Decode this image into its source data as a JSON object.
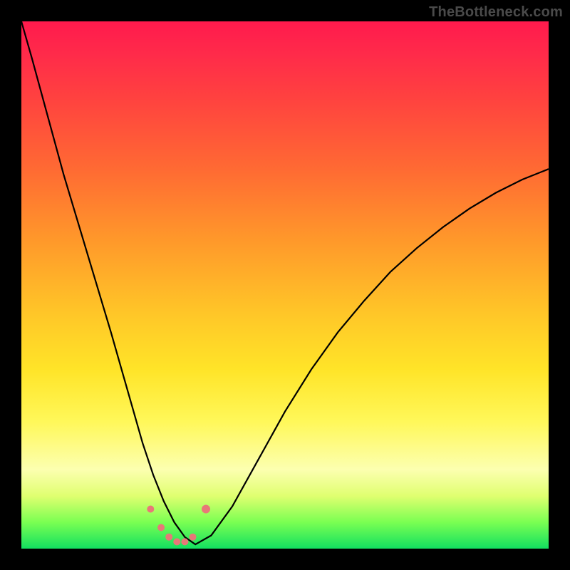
{
  "watermark": "TheBottleneck.com",
  "chart_data": {
    "type": "line",
    "title": "",
    "xlabel": "",
    "ylabel": "",
    "xlim": [
      0,
      100
    ],
    "ylim": [
      0,
      100
    ],
    "series": [
      {
        "name": "bottleneck-curve",
        "x": [
          0,
          2,
          5,
          8,
          11,
          14,
          17,
          19,
          21,
          23,
          25,
          27,
          29,
          31,
          33,
          36,
          40,
          45,
          50,
          55,
          60,
          65,
          70,
          75,
          80,
          85,
          90,
          95,
          100
        ],
        "y": [
          100,
          93,
          82,
          71,
          61,
          51,
          41,
          34,
          27,
          20,
          14,
          9,
          5,
          2.2,
          0.8,
          2.5,
          8,
          17,
          26,
          34,
          41,
          47,
          52.5,
          57,
          61,
          64.5,
          67.5,
          70,
          72
        ]
      }
    ],
    "markers": {
      "name": "highlight-points",
      "x": [
        24.5,
        26.5,
        28,
        29.5,
        31,
        32.5,
        35
      ],
      "y": [
        7.5,
        4,
        2.2,
        1.3,
        1.3,
        2.2,
        7.5
      ],
      "r": [
        5,
        5,
        5,
        5,
        5,
        5,
        6
      ]
    }
  }
}
